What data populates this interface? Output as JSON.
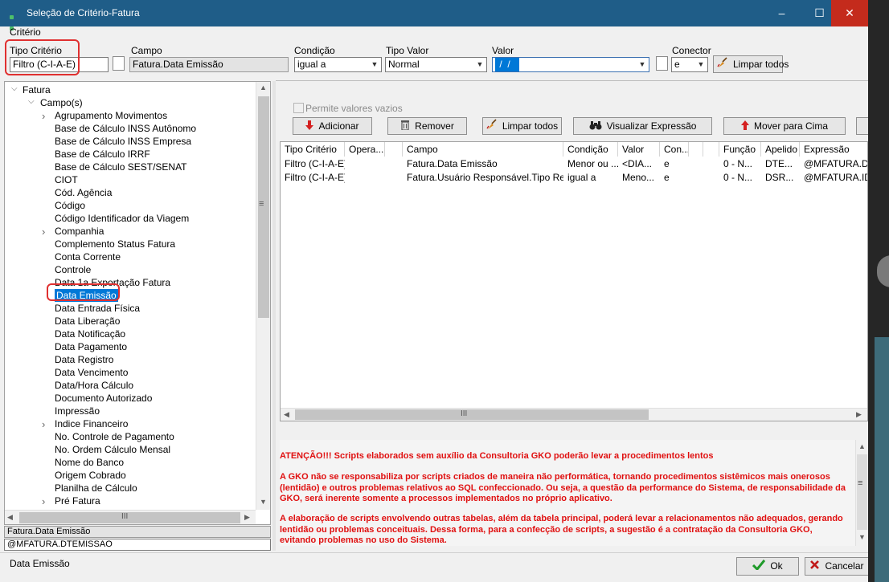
{
  "window": {
    "title": "Seleção de Critério-Fatura",
    "minimize": "–",
    "maximize": "☐",
    "close": "✕"
  },
  "criteria_group": "Critério",
  "tipo_criterio": {
    "label": "Tipo Critério",
    "value": "Filtro (C-I-A-E)"
  },
  "campo": {
    "label": "Campo",
    "value": "Fatura.Data Emissão"
  },
  "condicao": {
    "label": "Condição",
    "value": "igual a"
  },
  "tipo_valor": {
    "label": "Tipo Valor",
    "value": "Normal"
  },
  "valor": {
    "label": "Valor",
    "value": " /  / "
  },
  "conector": {
    "label": "Conector",
    "value": "e"
  },
  "limpar_todos_top": "Limpar todos",
  "permite_vazios": "Permite valores vazios",
  "toolbar": {
    "adicionar": "Adicionar",
    "remover": "Remover",
    "limpar_todos": "Limpar todos",
    "visualizar": "Visualizar Expressão",
    "mover_cima": "Mover para Cima"
  },
  "tree": {
    "root": "Fatura",
    "group": "Campo(s)",
    "items": [
      "Agrupamento Movimentos",
      "Base de Cálculo INSS Autônomo",
      "Base de Cálculo INSS Empresa",
      "Base de Cálculo IRRF",
      "Base de Cálculo SEST/SENAT",
      "CIOT",
      "Cód. Agência",
      "Código",
      "Código Identificador da Viagem",
      "Companhia",
      "Complemento Status Fatura",
      "Conta Corrente",
      "Controle",
      "Data 1a Exportação Fatura",
      "Data Emissão",
      "Data Entrada Física",
      "Data Liberação",
      "Data Notificação",
      "Data Pagamento",
      "Data Registro",
      "Data Vencimento",
      "Data/Hora Cálculo",
      "Documento Autorizado",
      "Impressão",
      "Indice Financeiro",
      "No. Controle de Pagamento",
      "No. Ordem Cálculo Mensal",
      "Nome do Banco",
      "Origem Cobrado",
      "Planilha de Cálculo",
      "Pré Fatura"
    ],
    "scroll_grip": "≡",
    "hscroll_grip": "III"
  },
  "selected_field": "Fatura.Data Emissão",
  "selected_expr": "@MFATURA.DTEMISSAO",
  "status_text": "Data Emissão",
  "grid": {
    "headers": [
      "Tipo Critério",
      "Opera...",
      "",
      "Campo",
      "Condição",
      "Valor",
      "Con...",
      "",
      "",
      "Função",
      "Apelido",
      "Expressão"
    ],
    "rows": [
      [
        "Filtro (C-I-A-E)",
        "",
        "",
        "Fatura.Data Emissão",
        "Menor ou ...",
        "<DIA...",
        "e",
        "",
        "",
        "0 - N...",
        "DTE...",
        "@MFATURA.DT"
      ],
      [
        "Filtro (C-I-A-E)",
        "",
        "",
        "Fatura.Usuário Responsável.Tipo Ref...",
        "igual a",
        "Meno...",
        "e",
        "",
        "",
        "0 - N...",
        "DSR...",
        "@MFATURA.IDU"
      ]
    ],
    "hscroll_grip": "III"
  },
  "warning": {
    "p1": "ATENÇÃO!!! Scripts elaborados sem auxílio da Consultoria GKO poderão levar a procedimentos lentos",
    "p2": "A GKO não se responsabiliza por scripts criados de maneira não performática, tornando procedimentos sistêmicos mais onerosos (lentidão) e outros problemas relativos ao SQL confeccionado. Ou seja, a questão da performance do Sistema, de responsabilidade da GKO, será inerente somente a processos implementados no próprio aplicativo.",
    "p3": "A elaboração de scripts envolvendo outras tabelas, além da tabela principal, poderá levar a relacionamentos não adequados, gerando lentidão ou problemas conceituais. Dessa forma, para a confecção de scripts, a sugestão é a contratação da Consultoria GKO, evitando problemas no uso do Sistema."
  },
  "ok": "Ok",
  "cancelar": "Cancelar",
  "colors": {
    "title_bg": "#1f5d88",
    "close_bg": "#c42b1c",
    "warning": "#e01010",
    "highlight": "#0078d7"
  }
}
